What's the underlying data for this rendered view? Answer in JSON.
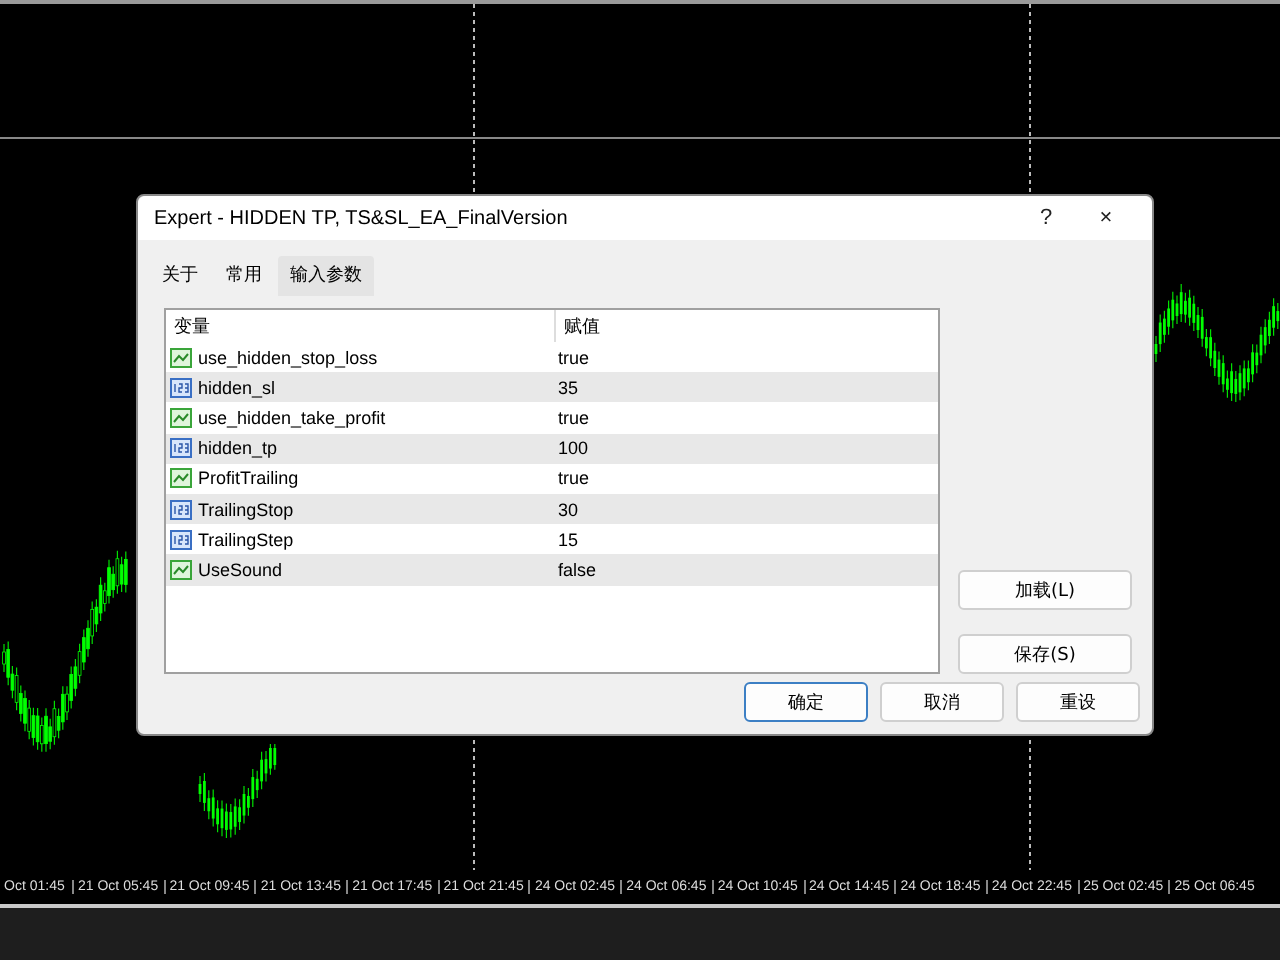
{
  "dialog": {
    "title": "Expert - HIDDEN TP, TS&SL_EA_FinalVersion",
    "help": "?",
    "close": "×",
    "tabs": [
      {
        "label": "关于",
        "selected": false
      },
      {
        "label": "常用",
        "selected": false
      },
      {
        "label": "输入参数",
        "selected": true
      }
    ],
    "table": {
      "columns": [
        "变量",
        "赋值"
      ],
      "rows": [
        {
          "kind": "bool",
          "name": "use_hidden_stop_loss",
          "value": "true"
        },
        {
          "kind": "int",
          "name": "hidden_sl",
          "value": "35"
        },
        {
          "kind": "bool",
          "name": "use_hidden_take_profit",
          "value": "true"
        },
        {
          "kind": "int",
          "name": "hidden_tp",
          "value": "100"
        },
        {
          "kind": "bool",
          "name": "ProfitTrailing",
          "value": "true"
        },
        {
          "kind": "int",
          "name": "TrailingStop",
          "value": "30"
        },
        {
          "kind": "int",
          "name": "TrailingStep",
          "value": "15"
        },
        {
          "kind": "bool",
          "name": "UseSound",
          "value": "false"
        }
      ]
    },
    "side_buttons": [
      "加载(L)",
      "保存(S)"
    ],
    "buttons": [
      {
        "label": "确定",
        "default": true
      },
      {
        "label": "取消",
        "default": false
      },
      {
        "label": "重设",
        "default": false
      }
    ]
  },
  "time_axis": [
    "Oct 01:45",
    "21 Oct 05:45",
    "21 Oct 09:45",
    "21 Oct 13:45",
    "21 Oct 17:45",
    "21 Oct 21:45",
    "24 Oct 02:45",
    "24 Oct 06:45",
    "24 Oct 10:45",
    "24 Oct 14:45",
    "24 Oct 18:45",
    "24 Oct 22:45",
    "25 Oct 02:45",
    "25 Oct 06:45"
  ]
}
